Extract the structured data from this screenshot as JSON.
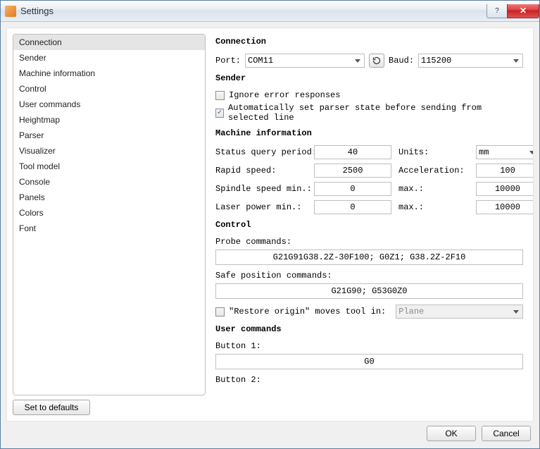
{
  "window": {
    "title": "Settings"
  },
  "sidebar": {
    "items": [
      "Connection",
      "Sender",
      "Machine information",
      "Control",
      "User commands",
      "Heightmap",
      "Parser",
      "Visualizer",
      "Tool model",
      "Console",
      "Panels",
      "Colors",
      "Font"
    ],
    "selected_index": 0
  },
  "buttons": {
    "set_defaults": "Set to defaults",
    "ok": "OK",
    "cancel": "Cancel"
  },
  "sections": {
    "connection": {
      "title": "Connection",
      "port_label": "Port:",
      "port_value": "COM11",
      "baud_label": "Baud:",
      "baud_value": "115200"
    },
    "sender": {
      "title": "Sender",
      "ignore_label": "Ignore error responses",
      "ignore_checked": false,
      "auto_parser_label": "Automatically set parser state before sending from selected line",
      "auto_parser_checked": true
    },
    "machine_info": {
      "title": "Machine information",
      "status_query_label": "Status query period:",
      "status_query_value": "40",
      "units_label": "Units:",
      "units_value": "mm",
      "rapid_label": "Rapid speed:",
      "rapid_value": "2500",
      "accel_label": "Acceleration:",
      "accel_value": "100",
      "spindle_min_label": "Spindle speed min.:",
      "spindle_min_value": "0",
      "spindle_max_label": "max.:",
      "spindle_max_value": "10000",
      "laser_min_label": "Laser power min.:",
      "laser_min_value": "0",
      "laser_max_label": "max.:",
      "laser_max_value": "10000"
    },
    "control": {
      "title": "Control",
      "probe_label": "Probe commands:",
      "probe_value": "G21G91G38.2Z-30F100; G0Z1; G38.2Z-2F10",
      "safe_label": "Safe position commands:",
      "safe_value": "G21G90; G53G0Z0",
      "restore_label": "\"Restore origin\" moves tool in:",
      "restore_checked": false,
      "restore_value": "Plane"
    },
    "user_commands": {
      "title": "User commands",
      "btn1_label": "Button 1:",
      "btn1_value": "G0",
      "btn2_label": "Button 2:"
    }
  }
}
